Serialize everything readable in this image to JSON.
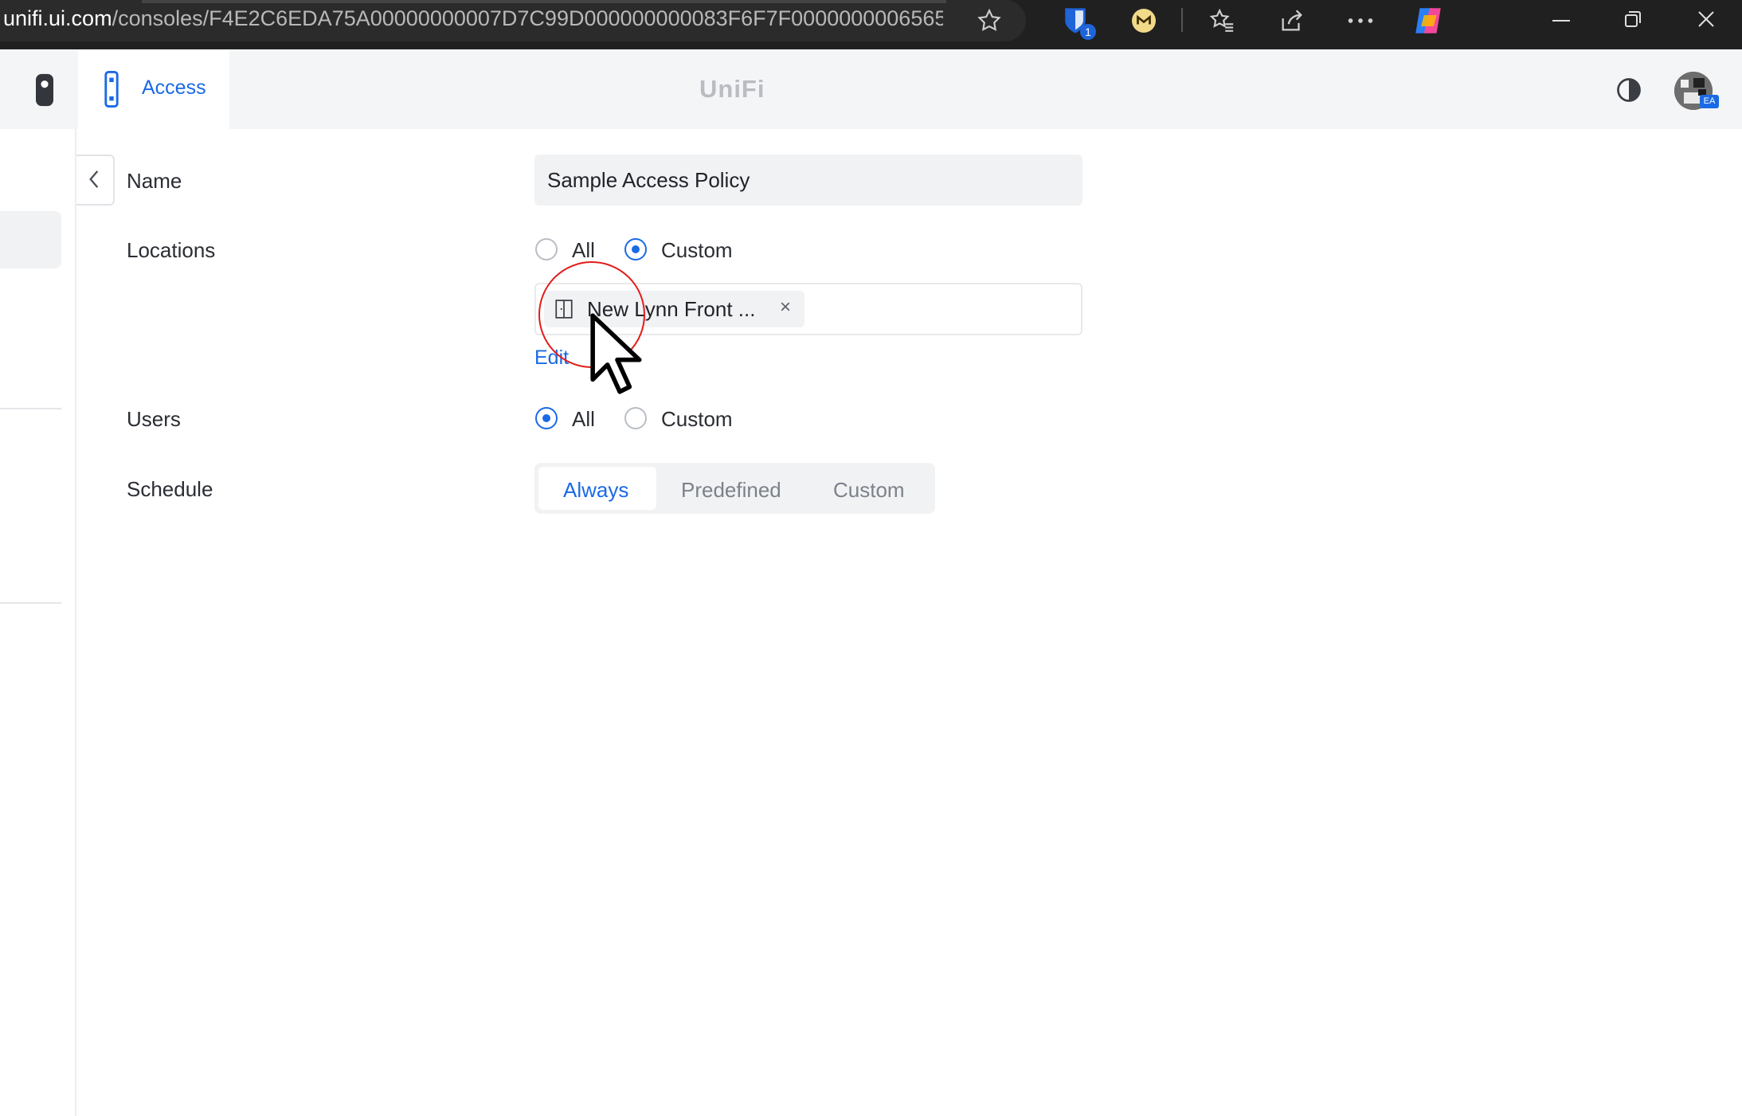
{
  "browser": {
    "address_host": "unifi.ui.com",
    "address_path": "/consoles/F4E2C6EDA75A00000000007D7C99D000000000083F6F7F00000000065658…",
    "extension_badge": "1",
    "icons": [
      "star-icon",
      "bitwarden-icon",
      "extension-icon",
      "favorites-icon",
      "share-icon",
      "more-icon",
      "copilot-icon",
      "minimize-icon",
      "restore-icon",
      "close-icon"
    ]
  },
  "header": {
    "app_tab_label": "Access",
    "logo_text": "UniFi",
    "avatar_badge": "EA"
  },
  "form": {
    "name": {
      "label": "Name",
      "value": "Sample Access Policy"
    },
    "locations": {
      "label": "Locations",
      "options": [
        "All",
        "Custom"
      ],
      "selected": "Custom",
      "chip_label": "New Lynn Front ...",
      "chip_remove": "×",
      "edit_label": "Edit"
    },
    "users": {
      "label": "Users",
      "options": [
        "All",
        "Custom"
      ],
      "selected": "All"
    },
    "schedule": {
      "label": "Schedule",
      "options": [
        "Always",
        "Predefined",
        "Custom"
      ],
      "selected": "Always"
    }
  },
  "colors": {
    "accent": "#1a6ae5",
    "annotation": "#e21b1b"
  }
}
